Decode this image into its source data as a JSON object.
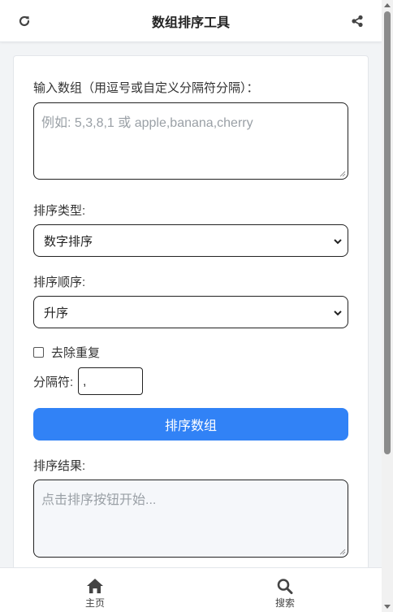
{
  "header": {
    "title": "数组排序工具"
  },
  "form": {
    "input_label": "输入数组（用逗号或自定义分隔符分隔）：",
    "input_placeholder": "例如: 5,3,8,1 或 apple,banana,cherry",
    "sort_type_label": "排序类型:",
    "sort_type_value": "数字排序",
    "sort_order_label": "排序顺序:",
    "sort_order_value": "升序",
    "dedupe_label": "去除重复",
    "dedupe_checked": false,
    "separator_label": "分隔符:",
    "separator_value": ",",
    "sort_button_label": "排序数组",
    "result_label": "排序结果:",
    "result_placeholder": "点击排序按钮开始..."
  },
  "bottom_nav": {
    "items": [
      {
        "label": "主页",
        "icon": "home-icon"
      },
      {
        "label": "搜索",
        "icon": "search-icon"
      }
    ]
  },
  "colors": {
    "accent": "#3182f6",
    "header_bg": "#ffffff",
    "page_bg": "#f2f4f6",
    "result_bg": "#f5f7fa",
    "icon_color": "#444444"
  }
}
